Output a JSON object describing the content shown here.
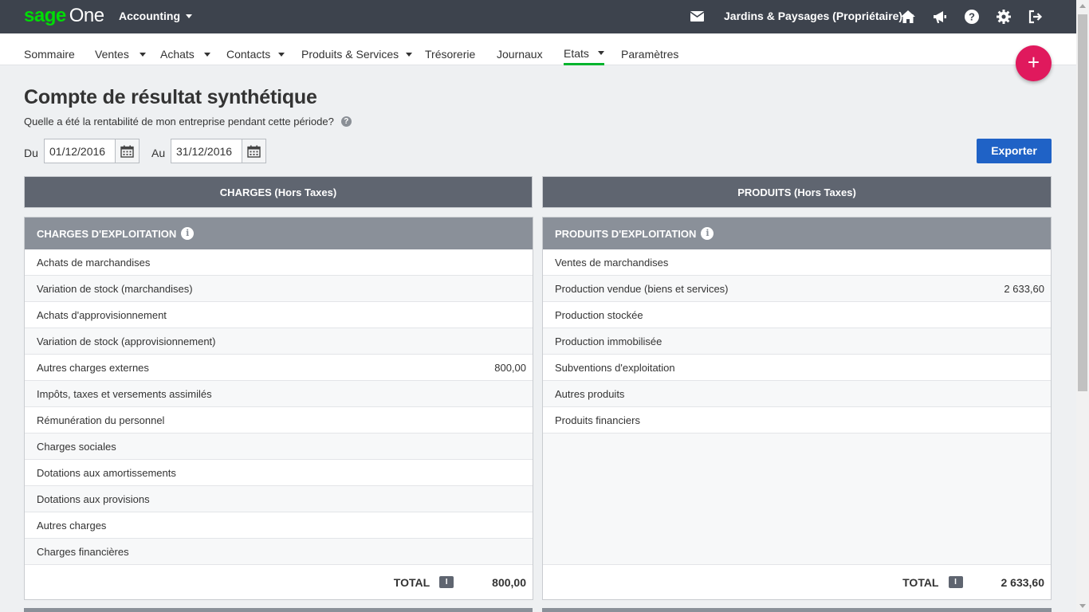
{
  "app": {
    "brand_sage": "sage",
    "brand_one": "One",
    "app_name": "Accounting",
    "company": "Jardins & Paysages (Propriétaire)",
    "icons": [
      "mail-icon",
      "home-icon",
      "megaphone-icon",
      "help-icon",
      "gear-icon",
      "logout-icon"
    ]
  },
  "nav": {
    "items": [
      {
        "label": "Sommaire"
      },
      {
        "label": "Ventes"
      },
      {
        "label": "Achats"
      },
      {
        "label": "Contacts"
      },
      {
        "label": "Produits & Services"
      },
      {
        "label": "Trésorerie"
      },
      {
        "label": "Journaux"
      },
      {
        "label": "Etats"
      },
      {
        "label": "Paramètres"
      }
    ],
    "active": "Etats"
  },
  "fab_label": "+",
  "page": {
    "title": "Compte de résultat synthétique",
    "subtitle": "Quelle a été la rentabilité de mon entreprise pendant cette période?",
    "help_glyph": "?",
    "from_label": "Du",
    "from_value": "01/12/2016",
    "to_label": "Au",
    "to_value": "31/12/2016",
    "export_label": "Exporter"
  },
  "charges": {
    "column_title": "CHARGES (Hors Taxes)",
    "section_title": "CHARGES D'EXPLOITATION",
    "rows": [
      {
        "label": "Achats de marchandises",
        "value": ""
      },
      {
        "label": "Variation de stock (marchandises)",
        "value": ""
      },
      {
        "label": "Achats d'approvisionnement",
        "value": ""
      },
      {
        "label": "Variation de stock (approvisionnement)",
        "value": ""
      },
      {
        "label": "Autres charges externes",
        "value": "800,00"
      },
      {
        "label": "Impôts, taxes et versements assimilés",
        "value": ""
      },
      {
        "label": "Rémunération du personnel",
        "value": ""
      },
      {
        "label": "Charges sociales",
        "value": ""
      },
      {
        "label": "Dotations aux amortissements",
        "value": ""
      },
      {
        "label": "Dotations aux provisions",
        "value": ""
      },
      {
        "label": "Autres charges",
        "value": ""
      },
      {
        "label": "Charges financières",
        "value": ""
      }
    ],
    "total_label": "TOTAL",
    "total_badge": "I",
    "total_value": "800,00"
  },
  "produits": {
    "column_title": "PRODUITS (Hors Taxes)",
    "section_title": "PRODUITS D'EXPLOITATION",
    "rows": [
      {
        "label": "Ventes de marchandises",
        "value": ""
      },
      {
        "label": "Production vendue (biens et services)",
        "value": "2 633,60"
      },
      {
        "label": "Production stockée",
        "value": ""
      },
      {
        "label": "Production immobilisée",
        "value": ""
      },
      {
        "label": "Subventions d'exploitation",
        "value": ""
      },
      {
        "label": "Autres produits",
        "value": ""
      },
      {
        "label": "Produits financiers",
        "value": ""
      }
    ],
    "total_label": "TOTAL",
    "total_badge": "I",
    "total_value": "2 633,60"
  },
  "colors": {
    "topbar": "#3d434d",
    "brand_green": "#00dc06",
    "active_underline": "#00b32d",
    "fab": "#e0195d",
    "export_button": "#1f62c6",
    "column_header": "#5f6570",
    "section_header": "#8a9099"
  }
}
